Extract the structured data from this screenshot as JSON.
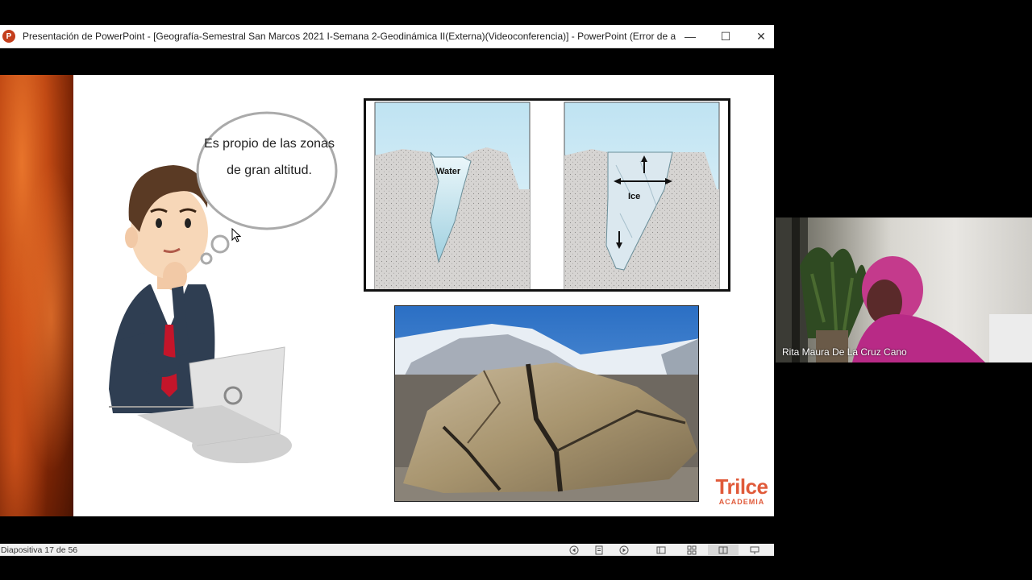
{
  "window": {
    "title": "Presentación de PowerPoint - [Geografía-Semestral San Marcos 2021 I-Semana 2-Geodinámica II(Externa)(Videoconferencia)] - PowerPoint (Error de activaci...",
    "app_icon_letter": "P",
    "minimize_glyph": "—",
    "maximize_glyph": "☐",
    "close_glyph": "✕"
  },
  "slide": {
    "thought_bubble_text": "Es propio de las zonas de gran altitud.",
    "diagram": {
      "left_label": "Water",
      "right_label": "Ice"
    },
    "logo": {
      "main": "Trilce",
      "sub": "ACADEMIA"
    }
  },
  "statusbar": {
    "slide_counter": "Diapositiva 17 de 56"
  },
  "video": {
    "participant_name": "Rita Maura De La Cruz Cano"
  },
  "colors": {
    "powerpoint_accent": "#c43e1c",
    "logo_red": "#e05a3a"
  }
}
